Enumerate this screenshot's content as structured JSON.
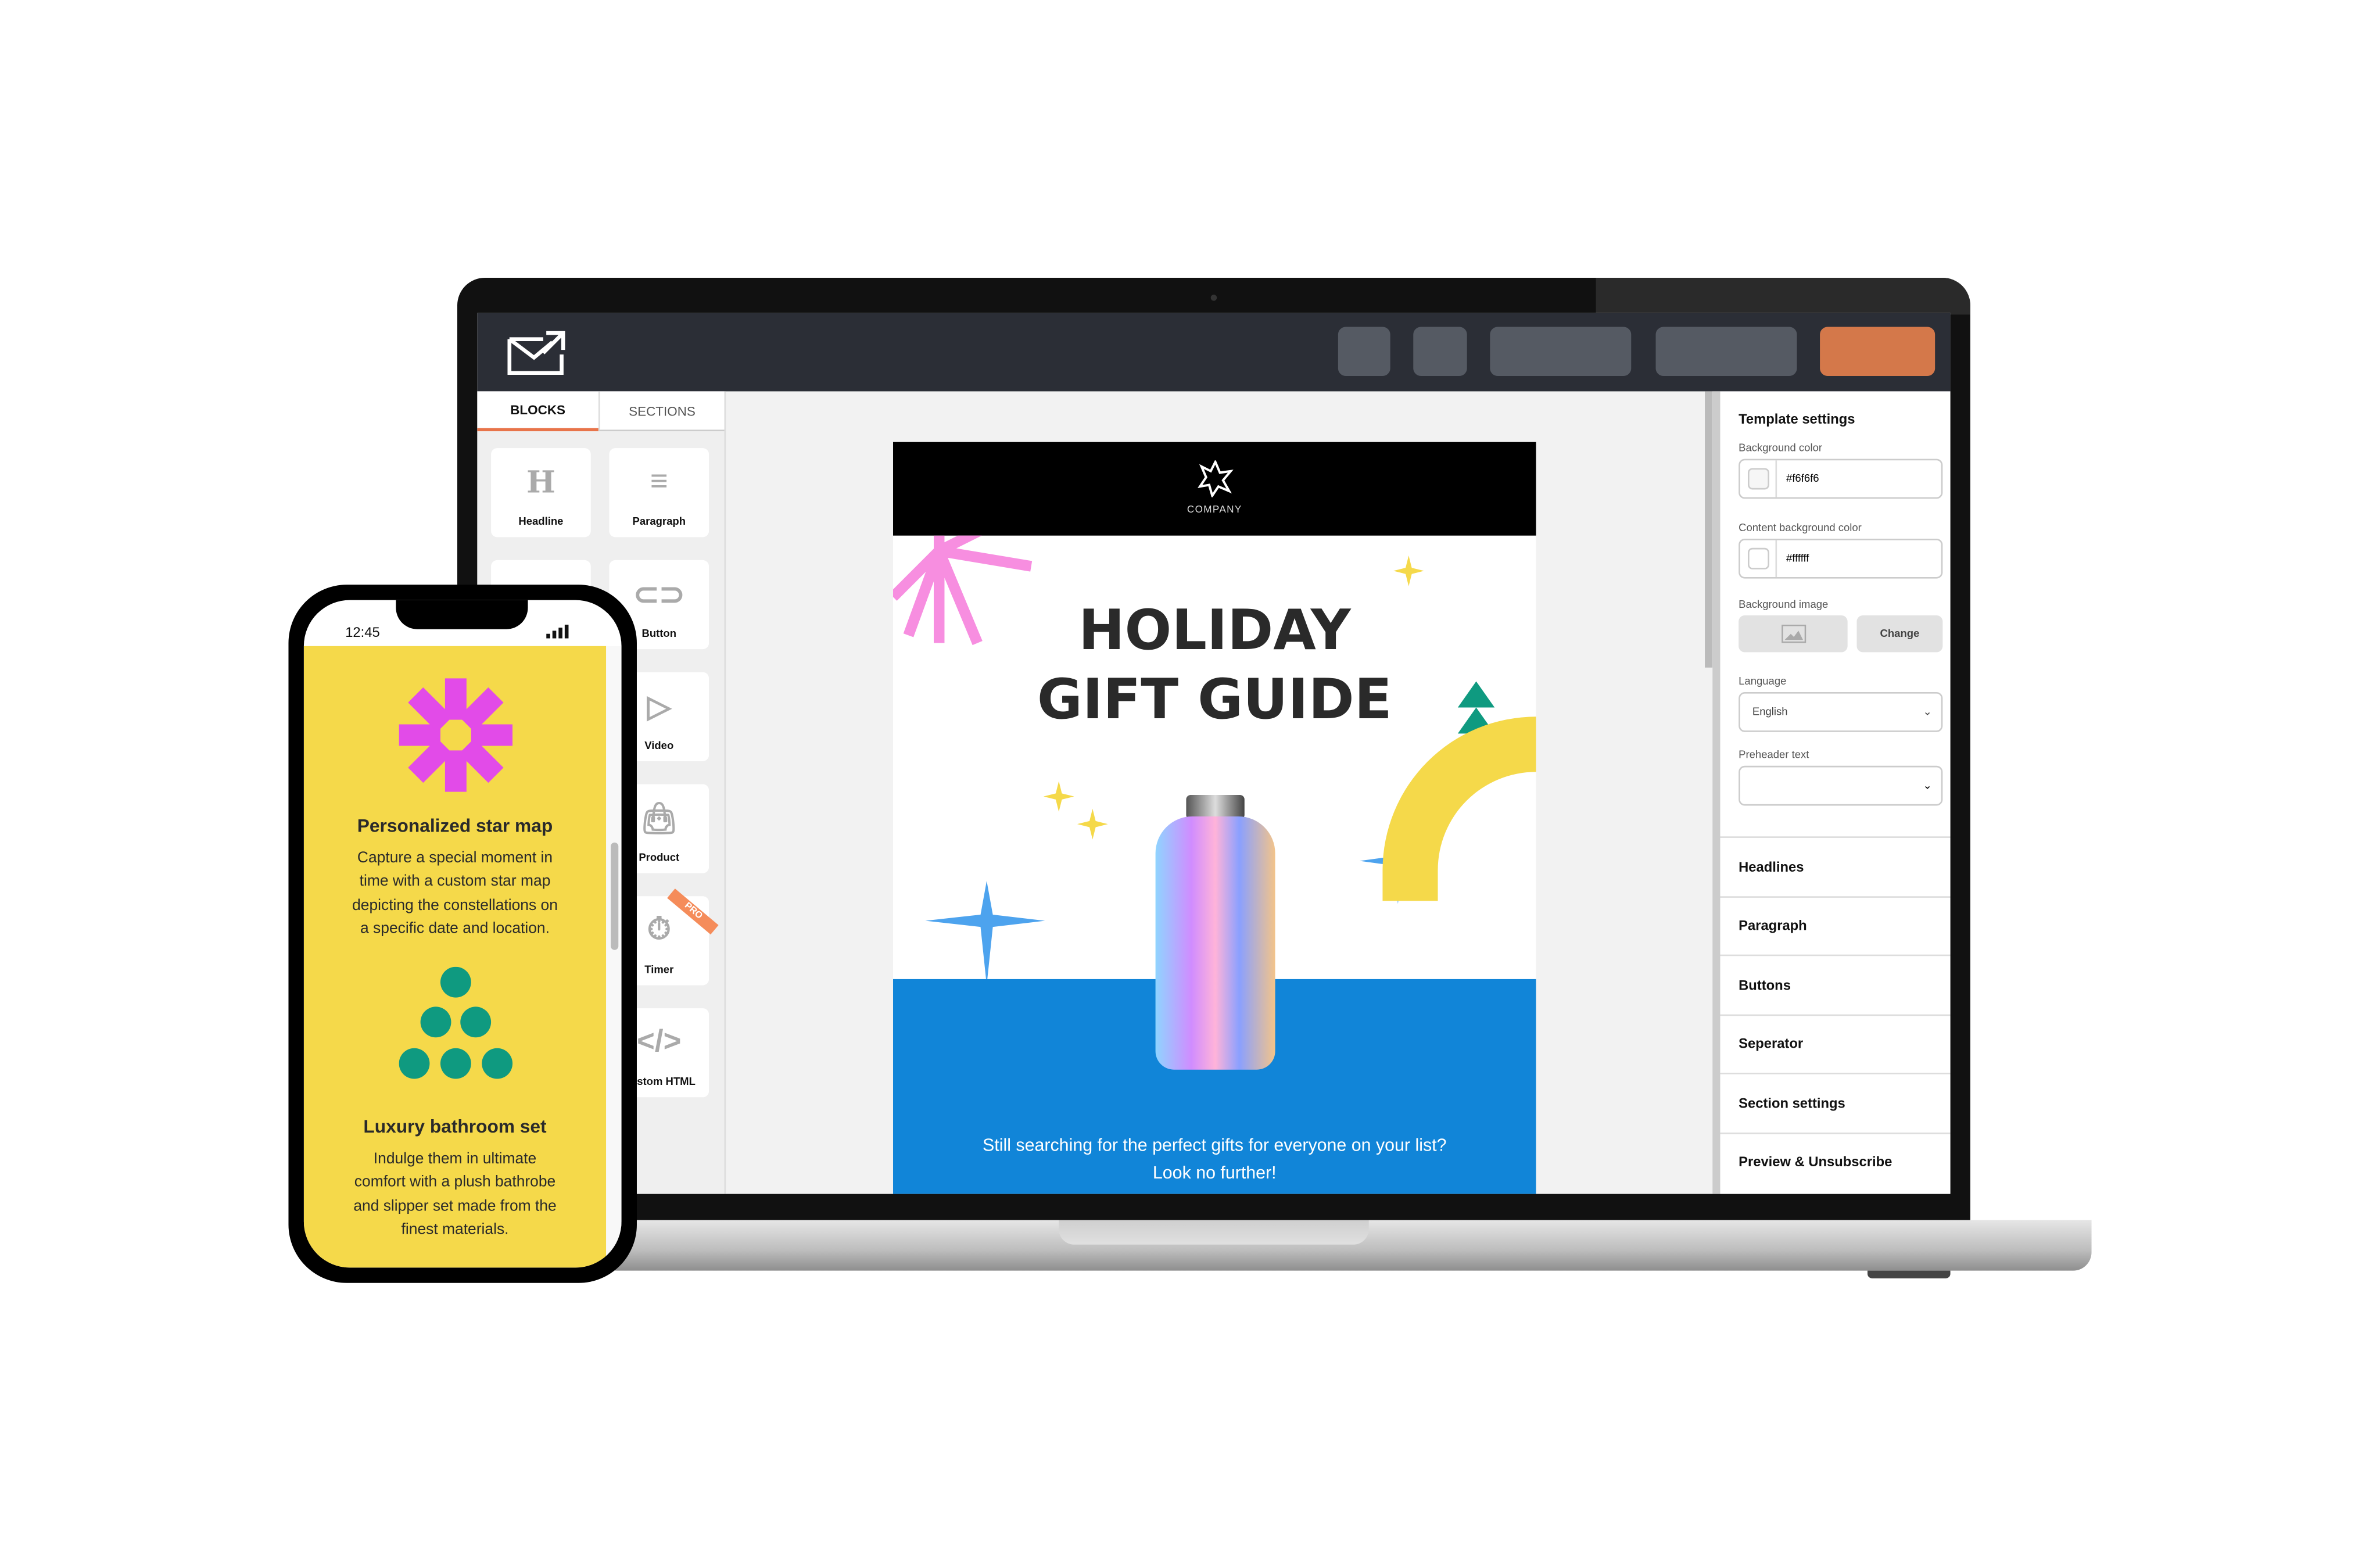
{
  "app": {
    "logo_icon": "envelope-arrow-icon",
    "accent_color": "#d4784a",
    "topbar_color": "#2b2e36"
  },
  "left_panel": {
    "tabs": [
      {
        "label": "BLOCKS",
        "active": true
      },
      {
        "label": "SECTIONS",
        "active": false
      }
    ],
    "blocks": [
      {
        "label": "Headline",
        "icon": "heading-icon"
      },
      {
        "label": "Paragraph",
        "icon": "paragraph-icon"
      },
      {
        "label": "",
        "icon": "image-icon"
      },
      {
        "label": "Button",
        "icon": "button-icon"
      },
      {
        "label": "",
        "icon": "divider-icon"
      },
      {
        "label": "Video",
        "icon": "video-icon"
      },
      {
        "label": "",
        "icon": "social-icon"
      },
      {
        "label": "Product",
        "icon": "shopping-bag-icon"
      },
      {
        "label": "",
        "icon": "spacer-icon"
      },
      {
        "label": "Timer",
        "icon": "stopwatch-icon",
        "badge": "PRO"
      },
      {
        "label": "",
        "icon": "menu-icon"
      },
      {
        "label": "Custom HTML",
        "icon": "code-icon"
      }
    ]
  },
  "email": {
    "company": "COMPANY",
    "title_line1": "HOLIDAY",
    "title_line2": "GIFT GUIDE",
    "body_line1": "Still searching for the perfect gifts for everyone on your list?",
    "body_line2": "Look no further!",
    "blue": "#1185d8"
  },
  "right_panel": {
    "title": "Template settings",
    "background_color": {
      "label": "Background color",
      "value": "#f6f6f6"
    },
    "content_background_color": {
      "label": "Content background color",
      "value": "#ffffff"
    },
    "background_image": {
      "label": "Background image",
      "change_label": "Change"
    },
    "language": {
      "label": "Language",
      "value": "English"
    },
    "preheader": {
      "label": "Preheader text",
      "value": ""
    },
    "sections": [
      "Headlines",
      "Paragraph",
      "Buttons",
      "Seperator",
      "Section settings",
      "Preview & Unsubscribe"
    ]
  },
  "phone": {
    "time": "12:45",
    "item1": {
      "title": "Personalized star map",
      "lines": [
        "Capture a special moment in",
        "time with a custom star map",
        "depicting the constellations on",
        "a specific date and location."
      ]
    },
    "item2": {
      "title": "Luxury bathroom set",
      "lines": [
        "Indulge them in ultimate",
        "comfort with a plush bathrobe",
        "and slipper set made from the",
        "finest materials."
      ]
    },
    "bg": "#f5d94a"
  }
}
